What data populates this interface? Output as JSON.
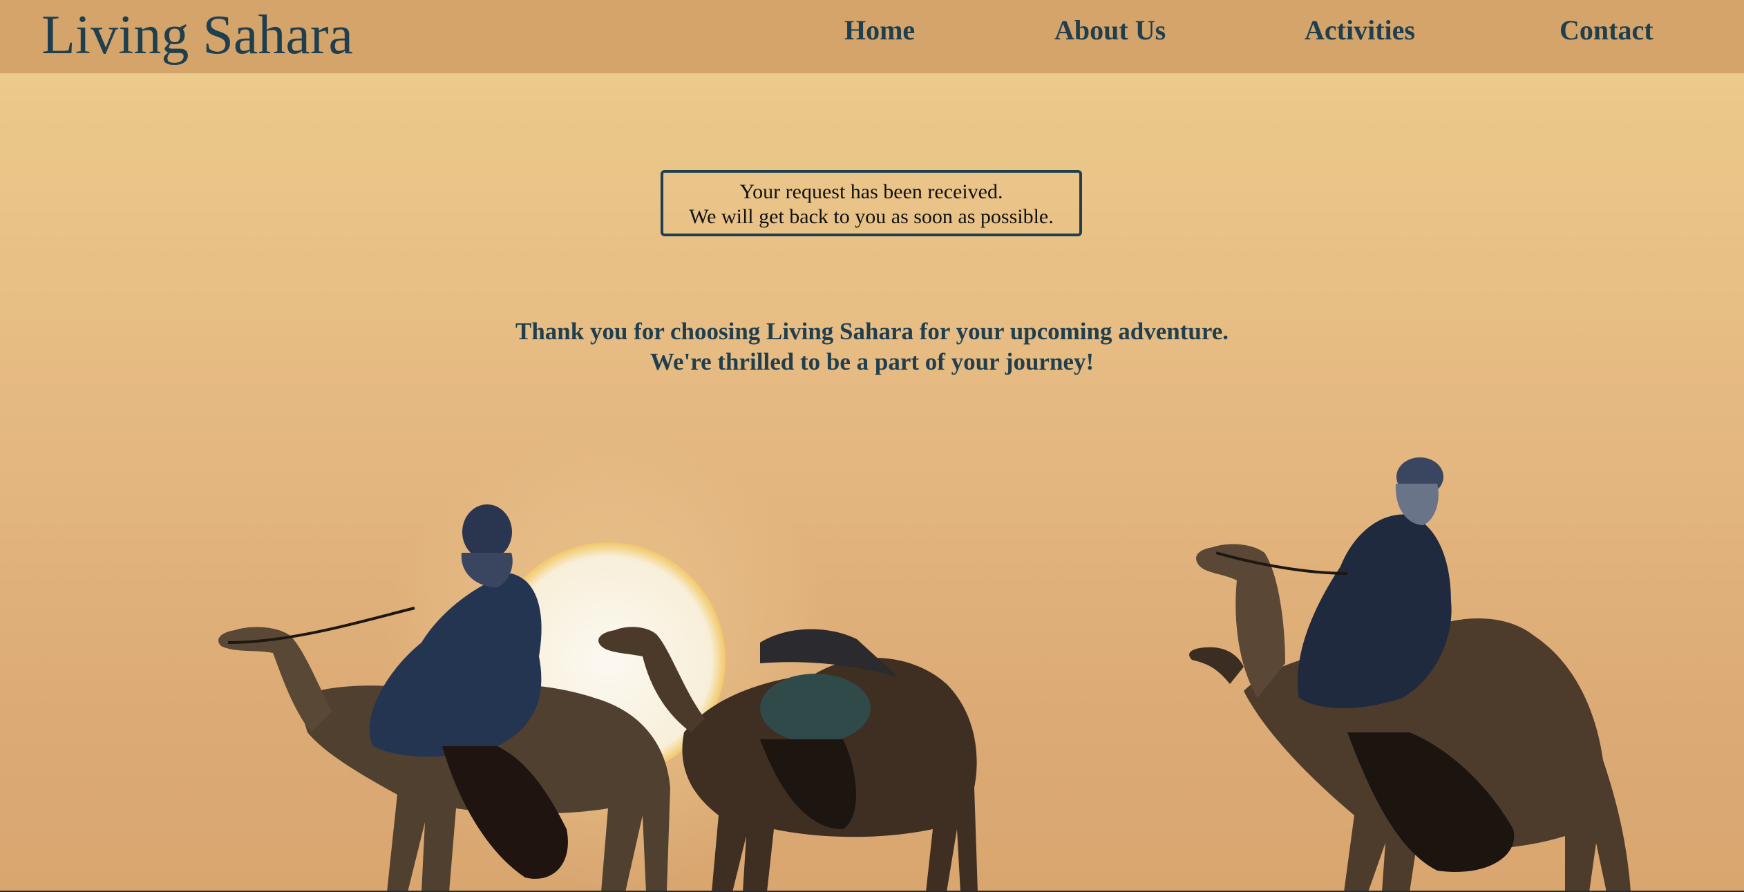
{
  "header": {
    "brand": "Living Sahara",
    "nav": [
      {
        "label": "Home"
      },
      {
        "label": "About Us"
      },
      {
        "label": "Activities"
      },
      {
        "label": "Contact"
      }
    ]
  },
  "notice": {
    "line1": "Your request has been received.",
    "line2": "We will get back to you as soon as possible."
  },
  "thanks": {
    "line1": "Thank you for choosing Living Sahara for your upcoming adventure.",
    "line2": "We're thrilled to be a part of your journey!"
  },
  "colors": {
    "header_bg": "#d4a46a",
    "text_primary": "#1f3f4f",
    "sky": "#e6bc83",
    "sun": "#faf6ee"
  },
  "background_image": {
    "icon": "camel-caravan-sunset-illustration"
  }
}
